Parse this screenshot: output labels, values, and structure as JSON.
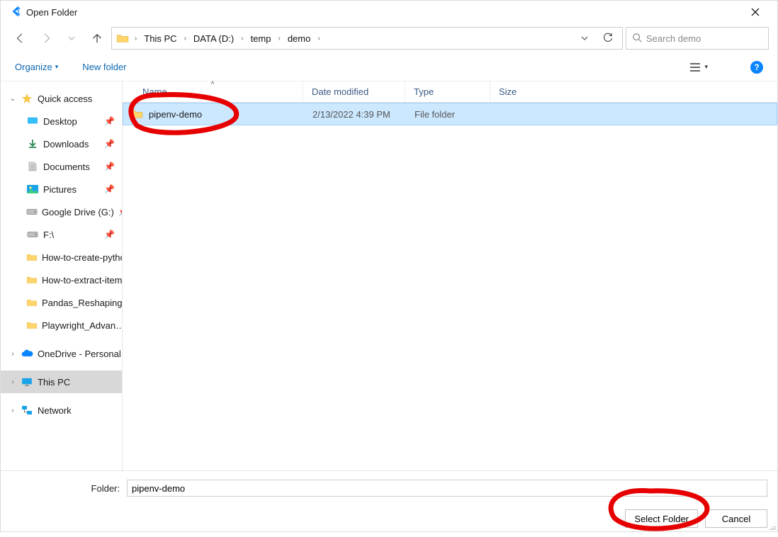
{
  "window": {
    "title": "Open Folder"
  },
  "breadcrumbs": [
    "This PC",
    "DATA (D:)",
    "temp",
    "demo"
  ],
  "search": {
    "placeholder": "Search demo"
  },
  "toolbar": {
    "organize": "Organize",
    "newfolder": "New folder"
  },
  "tree": {
    "quick": "Quick access",
    "desktop": "Desktop",
    "downloads": "Downloads",
    "documents": "Documents",
    "pictures": "Pictures",
    "gdrive": "Google Drive (G:)",
    "fdrive": "F:\\",
    "f1": "How-to-create-python…",
    "f2": "How-to-extract-items…",
    "f3": "Pandas_Reshaping…",
    "f4": "Playwright_Advan…",
    "onedrive": "OneDrive - Personal",
    "thispc": "This PC",
    "network": "Network"
  },
  "columns": {
    "name": "Name",
    "date": "Date modified",
    "type": "Type",
    "size": "Size"
  },
  "rows": [
    {
      "name": "pipenv-demo",
      "date": "2/13/2022 4:39 PM",
      "type": "File folder"
    }
  ],
  "footer": {
    "label": "Folder:",
    "value": "pipenv-demo",
    "select": "Select Folder",
    "cancel": "Cancel"
  }
}
